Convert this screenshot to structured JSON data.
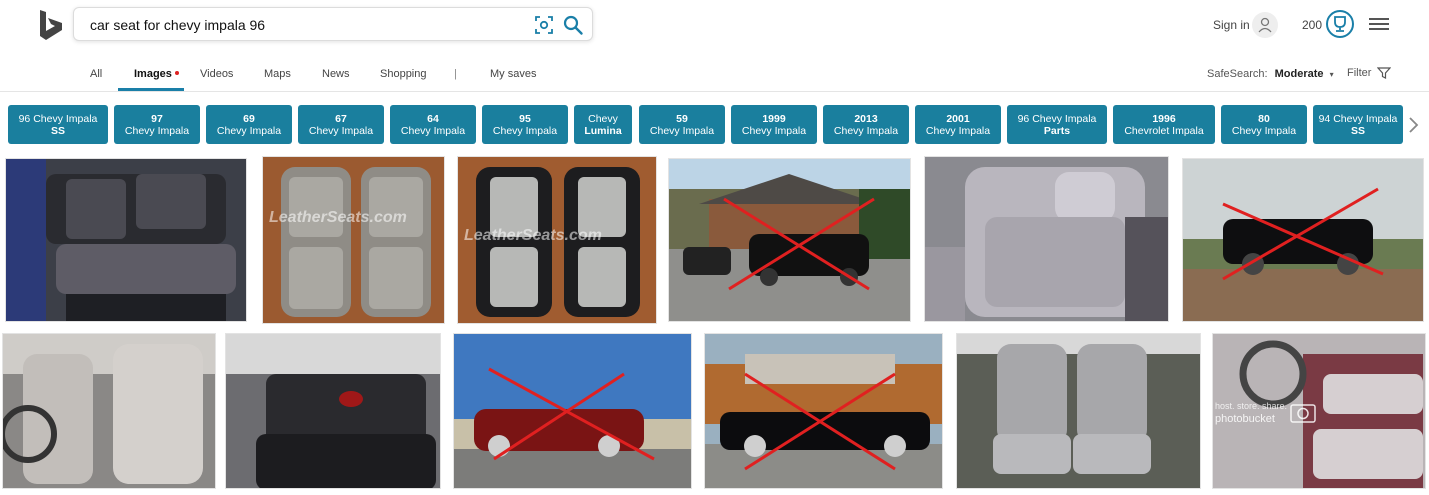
{
  "search": {
    "query": "car seat for chevy impala 96"
  },
  "account": {
    "signin_label": "Sign in",
    "points": "200"
  },
  "nav": {
    "tabs": [
      "All",
      "Images",
      "Videos",
      "Maps",
      "News",
      "Shopping"
    ],
    "separator": "|",
    "my_saves": "My saves",
    "safesearch_label": "SafeSearch:",
    "safesearch_value": "Moderate",
    "filter_label": "Filter"
  },
  "related": [
    {
      "l1": "96 Chevy Impala",
      "l2": "SS"
    },
    {
      "l1": "97",
      "l2": "Chevy Impala"
    },
    {
      "l1": "69",
      "l2": "Chevy Impala"
    },
    {
      "l1": "67",
      "l2": "Chevy Impala"
    },
    {
      "l1": "64",
      "l2": "Chevy Impala"
    },
    {
      "l1": "95",
      "l2": "Chevy Impala"
    },
    {
      "l1": "Chevy",
      "l2": "Lumina"
    },
    {
      "l1": "59",
      "l2": "Chevy Impala"
    },
    {
      "l1": "1999",
      "l2": "Chevy Impala"
    },
    {
      "l1": "2013",
      "l2": "Chevy Impala"
    },
    {
      "l1": "2001",
      "l2": "Chevy Impala"
    },
    {
      "l1": "96 Chevy Impala",
      "l2": "Parts"
    },
    {
      "l1": "1996",
      "l2": "Chevrolet Impala"
    },
    {
      "l1": "80",
      "l2": "Chevy Impala"
    },
    {
      "l1": "94 Chevy Impala",
      "l2": "SS"
    }
  ],
  "watermarks": {
    "leatherseats": "LeatherSeats.com",
    "photobucket": "photobucket",
    "photobucket_sub": "host. store. share."
  },
  "colors": {
    "accent": "#1a7f9e",
    "cross": "#e02020"
  }
}
